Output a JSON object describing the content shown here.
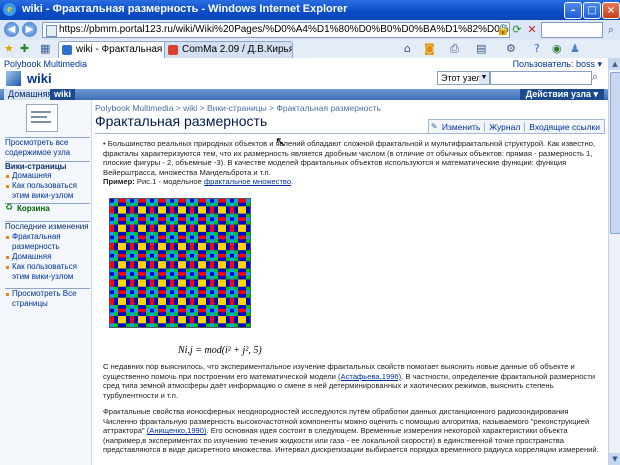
{
  "window": {
    "title": "wiki - Фрактальная размерность - Windows Internet Explorer",
    "minimize": "–",
    "maximize": "□",
    "close": "×"
  },
  "address": {
    "url": "https://pbmm.portal123.ru/wiki/Wiki%20Pages/%D0%A4%D1%80%D0%B0%D0%BA%D1%82%D0%B0%D0%BB%D1%8C"
  },
  "tabs": [
    {
      "label": "wiki - Фрактальная разм..."
    },
    {
      "label": "ComMa 2.09 / Д.В.Кирьяно..."
    }
  ],
  "sp": {
    "site_name": "Polybook Multimedia",
    "user_label": "Пользователь: boss ▾",
    "wiki_title": "wiki",
    "scope_value": "Этот узел",
    "nav_home": "Домашняя",
    "nav_wiki": "wiki",
    "actions_label": "Действия узла ▾"
  },
  "left_nav": {
    "view_all": "Просмотреть все содержимое узла",
    "wiki_pages_header": "Вики-страницы",
    "wiki_links": [
      "Домашняя",
      "Как пользоваться этим вики-узлом"
    ],
    "recycle": "Корзина",
    "recent_header": "Последние изменения",
    "recent_links": [
      "Фрактальная размерность",
      "Домашняя",
      "Как пользоваться этим вики-узлом"
    ],
    "view_all_pages": "Просмотреть Все страницы"
  },
  "content": {
    "breadcrumb": "Polybook Multimedia > wiki > Вики-страницы > Фрактальная размерность",
    "page_title": "Фрактальная размерность",
    "tab_edit": "Изменить",
    "tab_history": "Журнал",
    "tab_links": "Входящие ссылки",
    "para1": "Большинство реальных природных объектов и явлений обладают сложной фрактальной и мультифрактальной структурой. Как известно, фракталы характеризуются тем, что их размерность является дробным числом (в отличие от обычных объектов: прямая - размерность 1, плоские фигуры - 2, объемные -3). В качестве моделей фрактальных объектов используются и математические функции: функция Вейерштрасса, множества Мандельброта и т.п.",
    "example_label": "Пример:",
    "example_text": "Рис.1 - модельное",
    "example_link": "фрактальное множество",
    "formula": "Ni,j = mod(i² + j², 5)",
    "para2": "С недавних пор выяснилось, что экспериментальное изучение фрактальных свойств помогает выяснить новые данные об объекте и существенно помочь при построении его математической модели",
    "para2_link": "(Астафьева,1996)",
    "para2_tail": ". В частности, определение фрактальной размерности сред типа земной атмосферы даёт информацию о смене в ней детерминированных и хаотических режимов, выяснить степень турбулентности и т.п.",
    "para3": "Фрактальные свойства ионосферных неоднородностей исследуются путём обработки данных дистанционного радиозондирования Численно фрактальную размерность высокочастотной компоненты можно оценить с помощью алгоритма, называемого \"реконструкцией аттрактора\"",
    "para3_link": "(Анищенко,1990)",
    "para3_tail": ". Его основная идея состоит в следующем. Временные измерения некоторой характеристики объекта (например,в экспериментах по изучению течения жидкости или газа - ее локальной скорости) в единственной точке пространства представляются в виде дискретного множества. Интервал дискретизации выбирается порядка временного радиуса корреляции измерений."
  },
  "fractal": {
    "modulus": 5,
    "palette": [
      "#0000c8",
      "#00a6ff",
      "#00c800",
      "#ffd700",
      "#ff0000"
    ]
  }
}
